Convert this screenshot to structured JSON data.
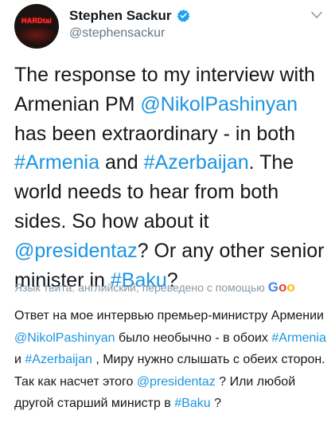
{
  "author": {
    "display_name": "Stephen Sackur",
    "handle": "@stephensackur",
    "avatar_text": "HARDtal"
  },
  "tweet": {
    "parts": [
      "The response to my interview with Armenian PM ",
      "@NikolPashinyan",
      " has been extraordinary - in both ",
      "#Armenia",
      " and ",
      "#Azerbaijan",
      ". The world needs to hear from both sides. So how about it ",
      "@presidentaz",
      "? Or any other senior minister in ",
      "#Baku",
      "?"
    ]
  },
  "translation": {
    "label": "Язык твита: английский, переведено с помощью",
    "brand_letters": [
      "G",
      "o",
      "o"
    ],
    "parts": [
      "Ответ на мое интервью премьер-министру Армении ",
      "@NikolPashinyan",
      " было необычно - в обоих ",
      "#Armenia",
      " и ",
      "#Azerbaijan",
      " , Миру нужно слышать с обеих сторон. Так как насчет этого ",
      "@presidentaz",
      " ? Или любой другой старший министр в ",
      "#Baku",
      " ?"
    ]
  },
  "colors": {
    "link": "#1b95e0",
    "verified": "#1da1f2",
    "secondary_text": "#657786"
  },
  "icons": {
    "verified": "verified-badge-icon",
    "menu": "chevron-down-icon"
  }
}
